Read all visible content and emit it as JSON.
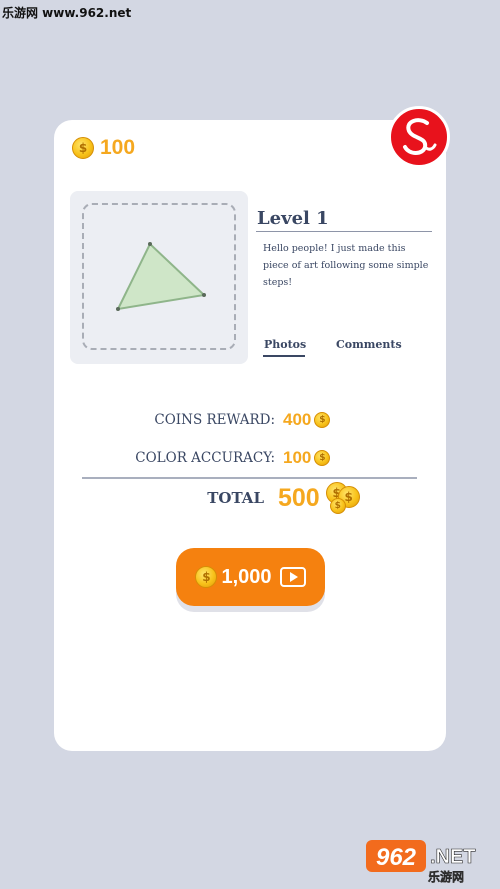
{
  "watermark_top": "乐游网 www.962.net",
  "header": {
    "coins": "100"
  },
  "artwork": {
    "shape_name": "triangle-drawing"
  },
  "level": {
    "title": "Level  1",
    "description": "Hello people! I just made this piece of art following some simple steps!"
  },
  "tabs": [
    {
      "label": "Photos",
      "active": true
    },
    {
      "label": "Comments",
      "active": false
    }
  ],
  "rewards": {
    "coins_reward_label": "COINS REWARD:",
    "coins_reward_value": "400",
    "color_accuracy_label": "COLOR ACCURACY:",
    "color_accuracy_value": "100",
    "total_label": "TOTAL",
    "total_value": "500"
  },
  "claim_button": {
    "value": "1,000",
    "icon": "video-play-icon"
  },
  "logo_bottom": {
    "number": "962",
    "suffix": ".NET",
    "subtitle": "乐游网"
  },
  "colors": {
    "background": "#d3d7e3",
    "card": "#ffffff",
    "coin_text": "#f5a81f",
    "button": "#f5810f",
    "text_dark": "#3a4763",
    "brand_red": "#e8121c"
  }
}
